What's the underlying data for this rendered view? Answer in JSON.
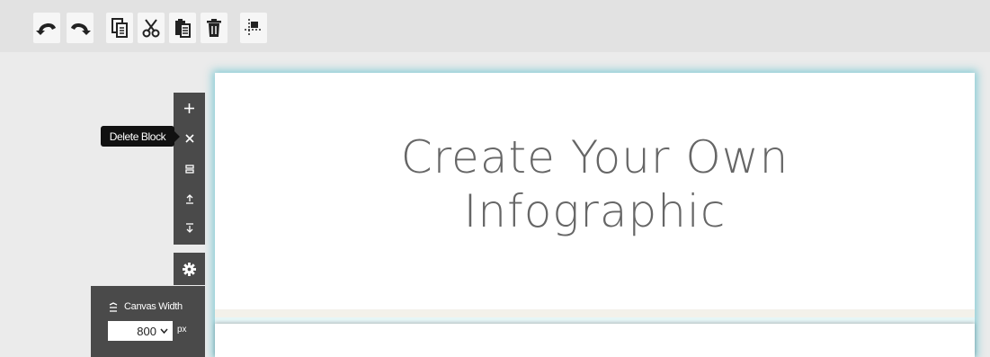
{
  "toolbar": {
    "buttons": [
      {
        "name": "undo-button",
        "icon": "undo-icon"
      },
      {
        "name": "redo-button",
        "icon": "redo-icon"
      },
      {
        "name": "copy-button",
        "icon": "copy-icon"
      },
      {
        "name": "cut-button",
        "icon": "scissors-icon"
      },
      {
        "name": "paste-button",
        "icon": "clipboard-icon"
      },
      {
        "name": "delete-button",
        "icon": "trash-icon"
      },
      {
        "name": "guides-button",
        "icon": "grid-guides-icon"
      }
    ]
  },
  "block_controls": {
    "add_icon": "plus-icon",
    "delete_icon": "close-icon",
    "resize_icon": "resize-icon",
    "move_up_icon": "move-up-icon",
    "move_down_icon": "move-down-icon",
    "settings_icon": "gear-icon"
  },
  "tooltip": {
    "text": "Delete Block"
  },
  "canvas": {
    "title_line1": "Create Your Own",
    "title_line2": "Infographic"
  },
  "canvas_width": {
    "label": "Canvas Width",
    "value": "800",
    "unit": "px"
  },
  "colors": {
    "canvas_glow": "#78c8d2",
    "panel_bg": "#4a4a4a",
    "title_text": "#666666"
  }
}
